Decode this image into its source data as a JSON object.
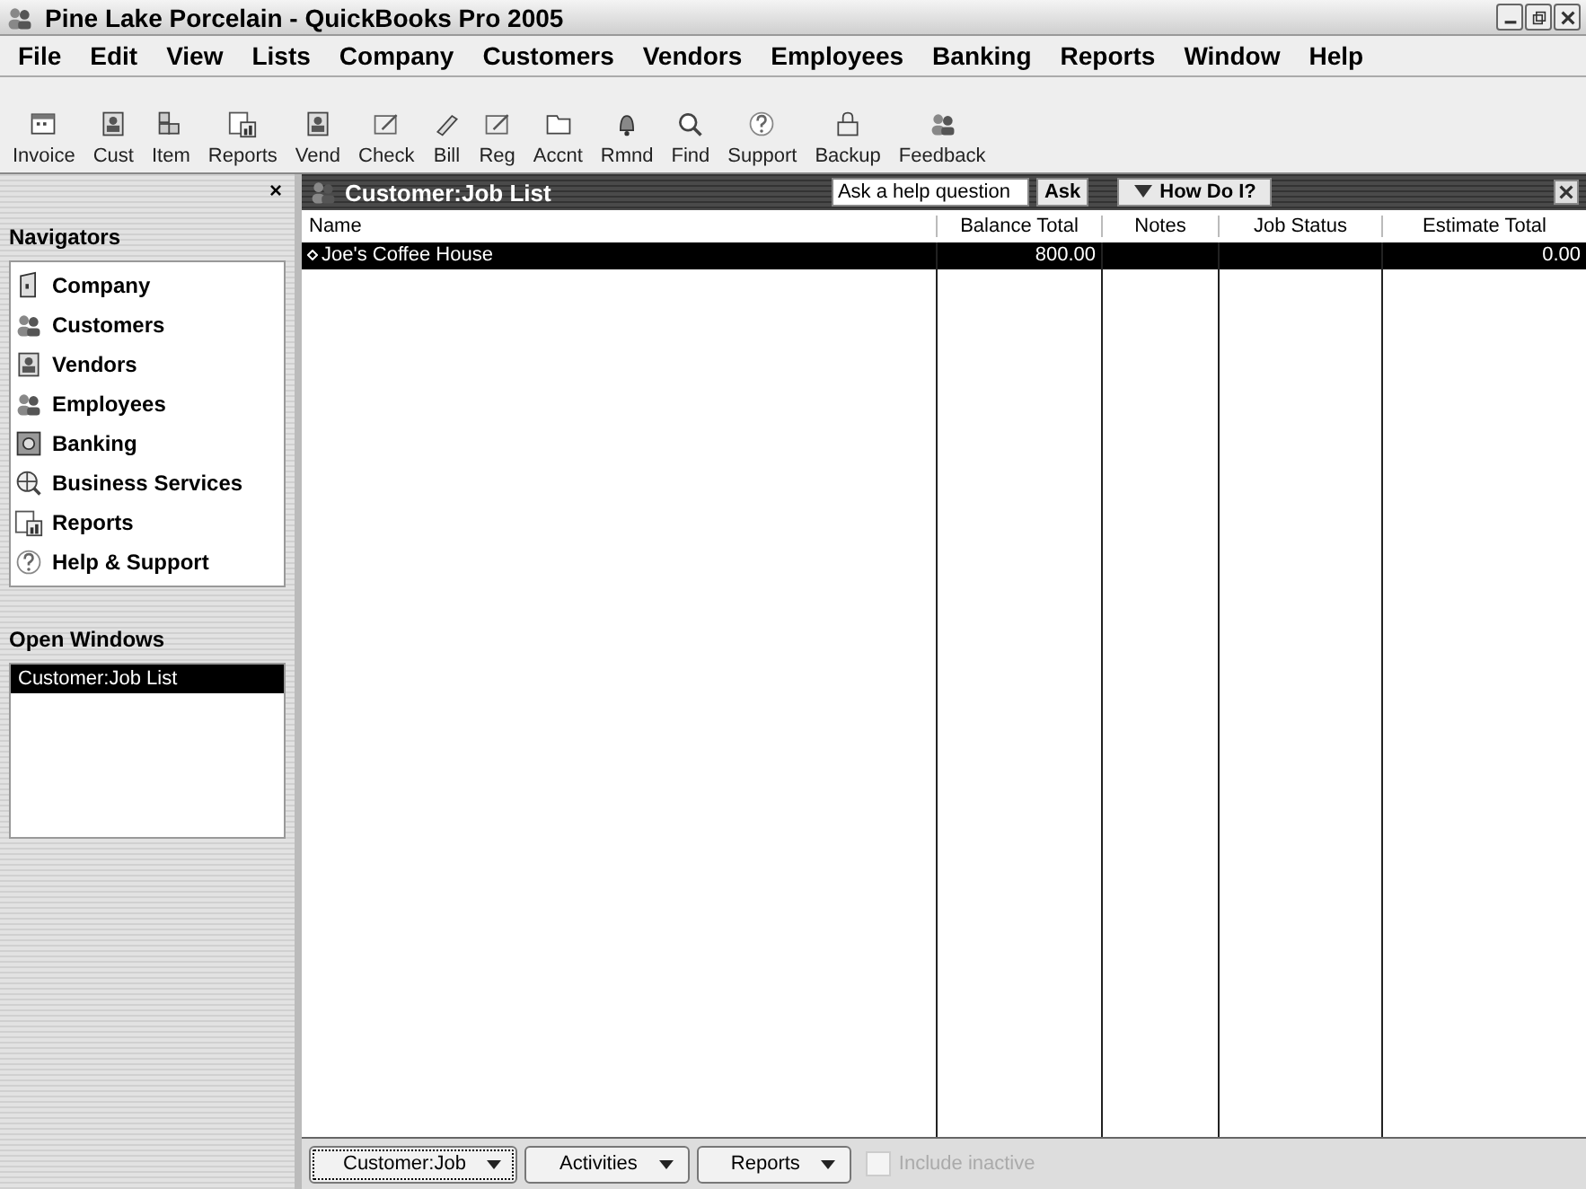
{
  "window": {
    "title": "Pine Lake Porcelain - QuickBooks Pro 2005"
  },
  "menu": [
    "File",
    "Edit",
    "View",
    "Lists",
    "Company",
    "Customers",
    "Vendors",
    "Employees",
    "Banking",
    "Reports",
    "Window",
    "Help"
  ],
  "toolbar": [
    "Invoice",
    "Cust",
    "Item",
    "Reports",
    "Vend",
    "Check",
    "Bill",
    "Reg",
    "Accnt",
    "Rmnd",
    "Find",
    "Support",
    "Backup",
    "Feedback"
  ],
  "sidebar": {
    "close": "×",
    "title": "Navigators",
    "items": [
      {
        "label": "Company"
      },
      {
        "label": "Customers"
      },
      {
        "label": "Vendors"
      },
      {
        "label": "Employees"
      },
      {
        "label": "Banking"
      },
      {
        "label": "Business Services"
      },
      {
        "label": "Reports"
      },
      {
        "label": "Help & Support"
      }
    ],
    "open_windows_title": "Open Windows",
    "open_windows": [
      {
        "label": "Customer:Job List",
        "selected": true
      }
    ]
  },
  "list_window": {
    "title": "Customer:Job List",
    "help_placeholder": "Ask a help question",
    "ask": "Ask",
    "how_do_i": "How Do I?",
    "columns": [
      "Name",
      "Balance Total",
      "Notes",
      "Job Status",
      "Estimate Total"
    ],
    "rows": [
      {
        "cells": [
          "Joe's Coffee House",
          "800.00",
          "",
          "",
          "0.00"
        ],
        "selected": true
      }
    ],
    "buttons": [
      "Customer:Job",
      "Activities",
      "Reports"
    ],
    "include_inactive": {
      "label": "Include inactive",
      "checked": false,
      "disabled": true
    }
  }
}
